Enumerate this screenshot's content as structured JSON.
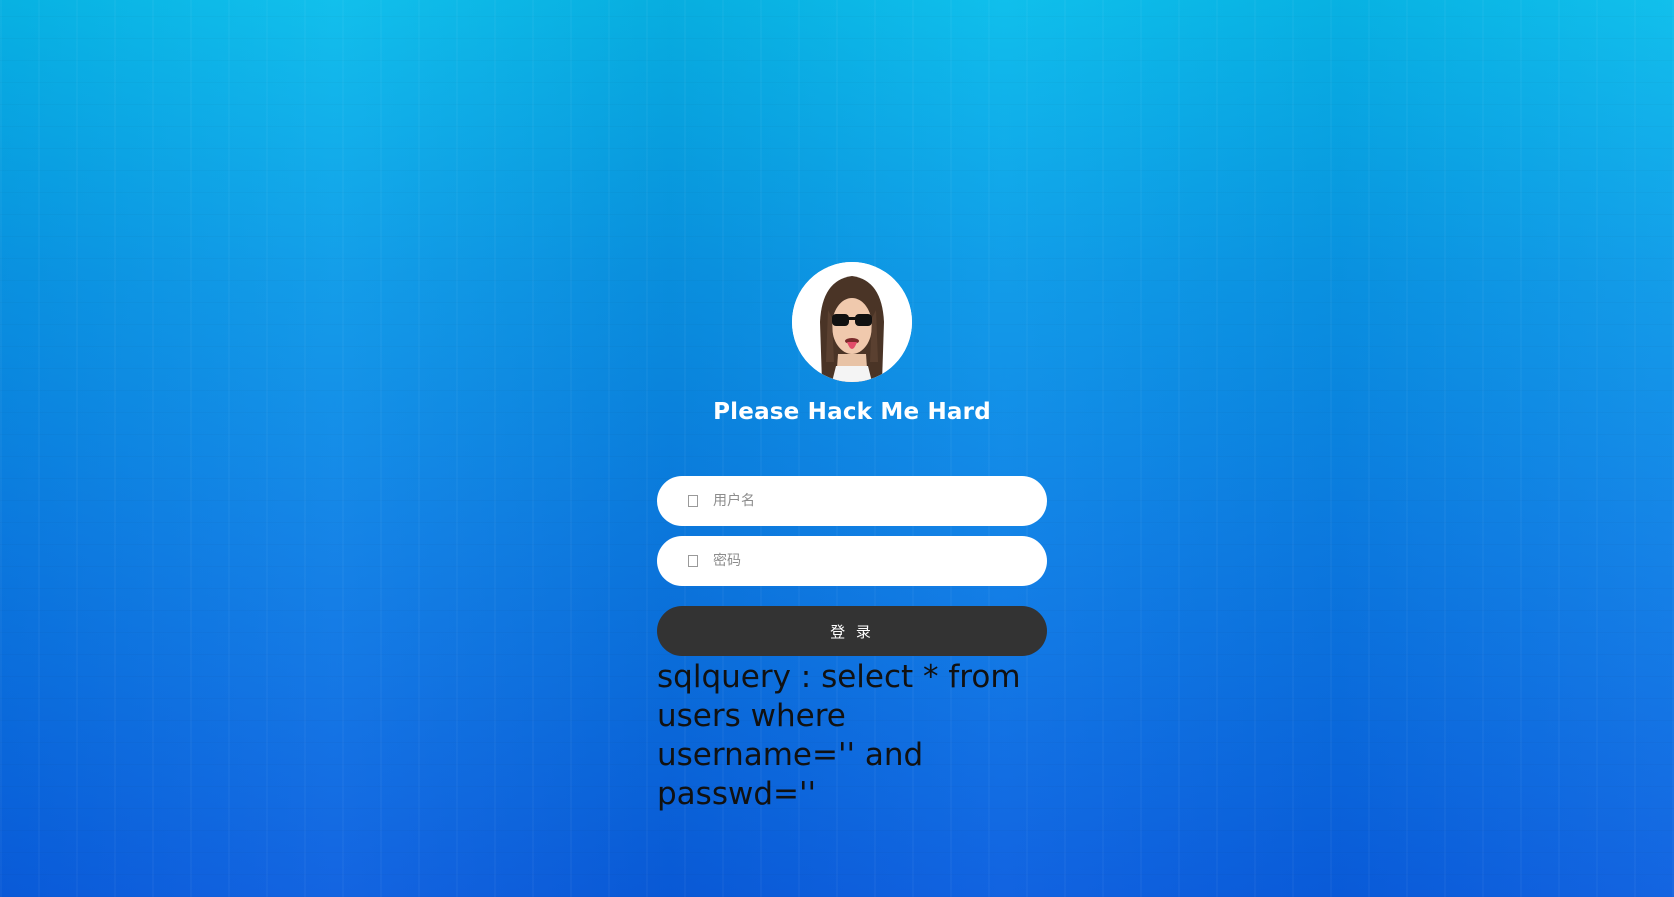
{
  "login": {
    "title": "Please Hack Me Hard",
    "username_placeholder": "用户名",
    "password_placeholder": "密码",
    "submit_label": "登 录",
    "sql_output": "sqlquery : select * from users where username='' and passwd=''"
  },
  "icons": {
    "username_icon": "user-icon",
    "password_icon": "lock-icon"
  },
  "colors": {
    "background_top": "#08bdeb",
    "background_bottom": "#0a5ee0",
    "field_bg": "#ffffff",
    "button_bg": "#333333",
    "title_color": "#ffffff",
    "sql_text_color": "#111111"
  }
}
